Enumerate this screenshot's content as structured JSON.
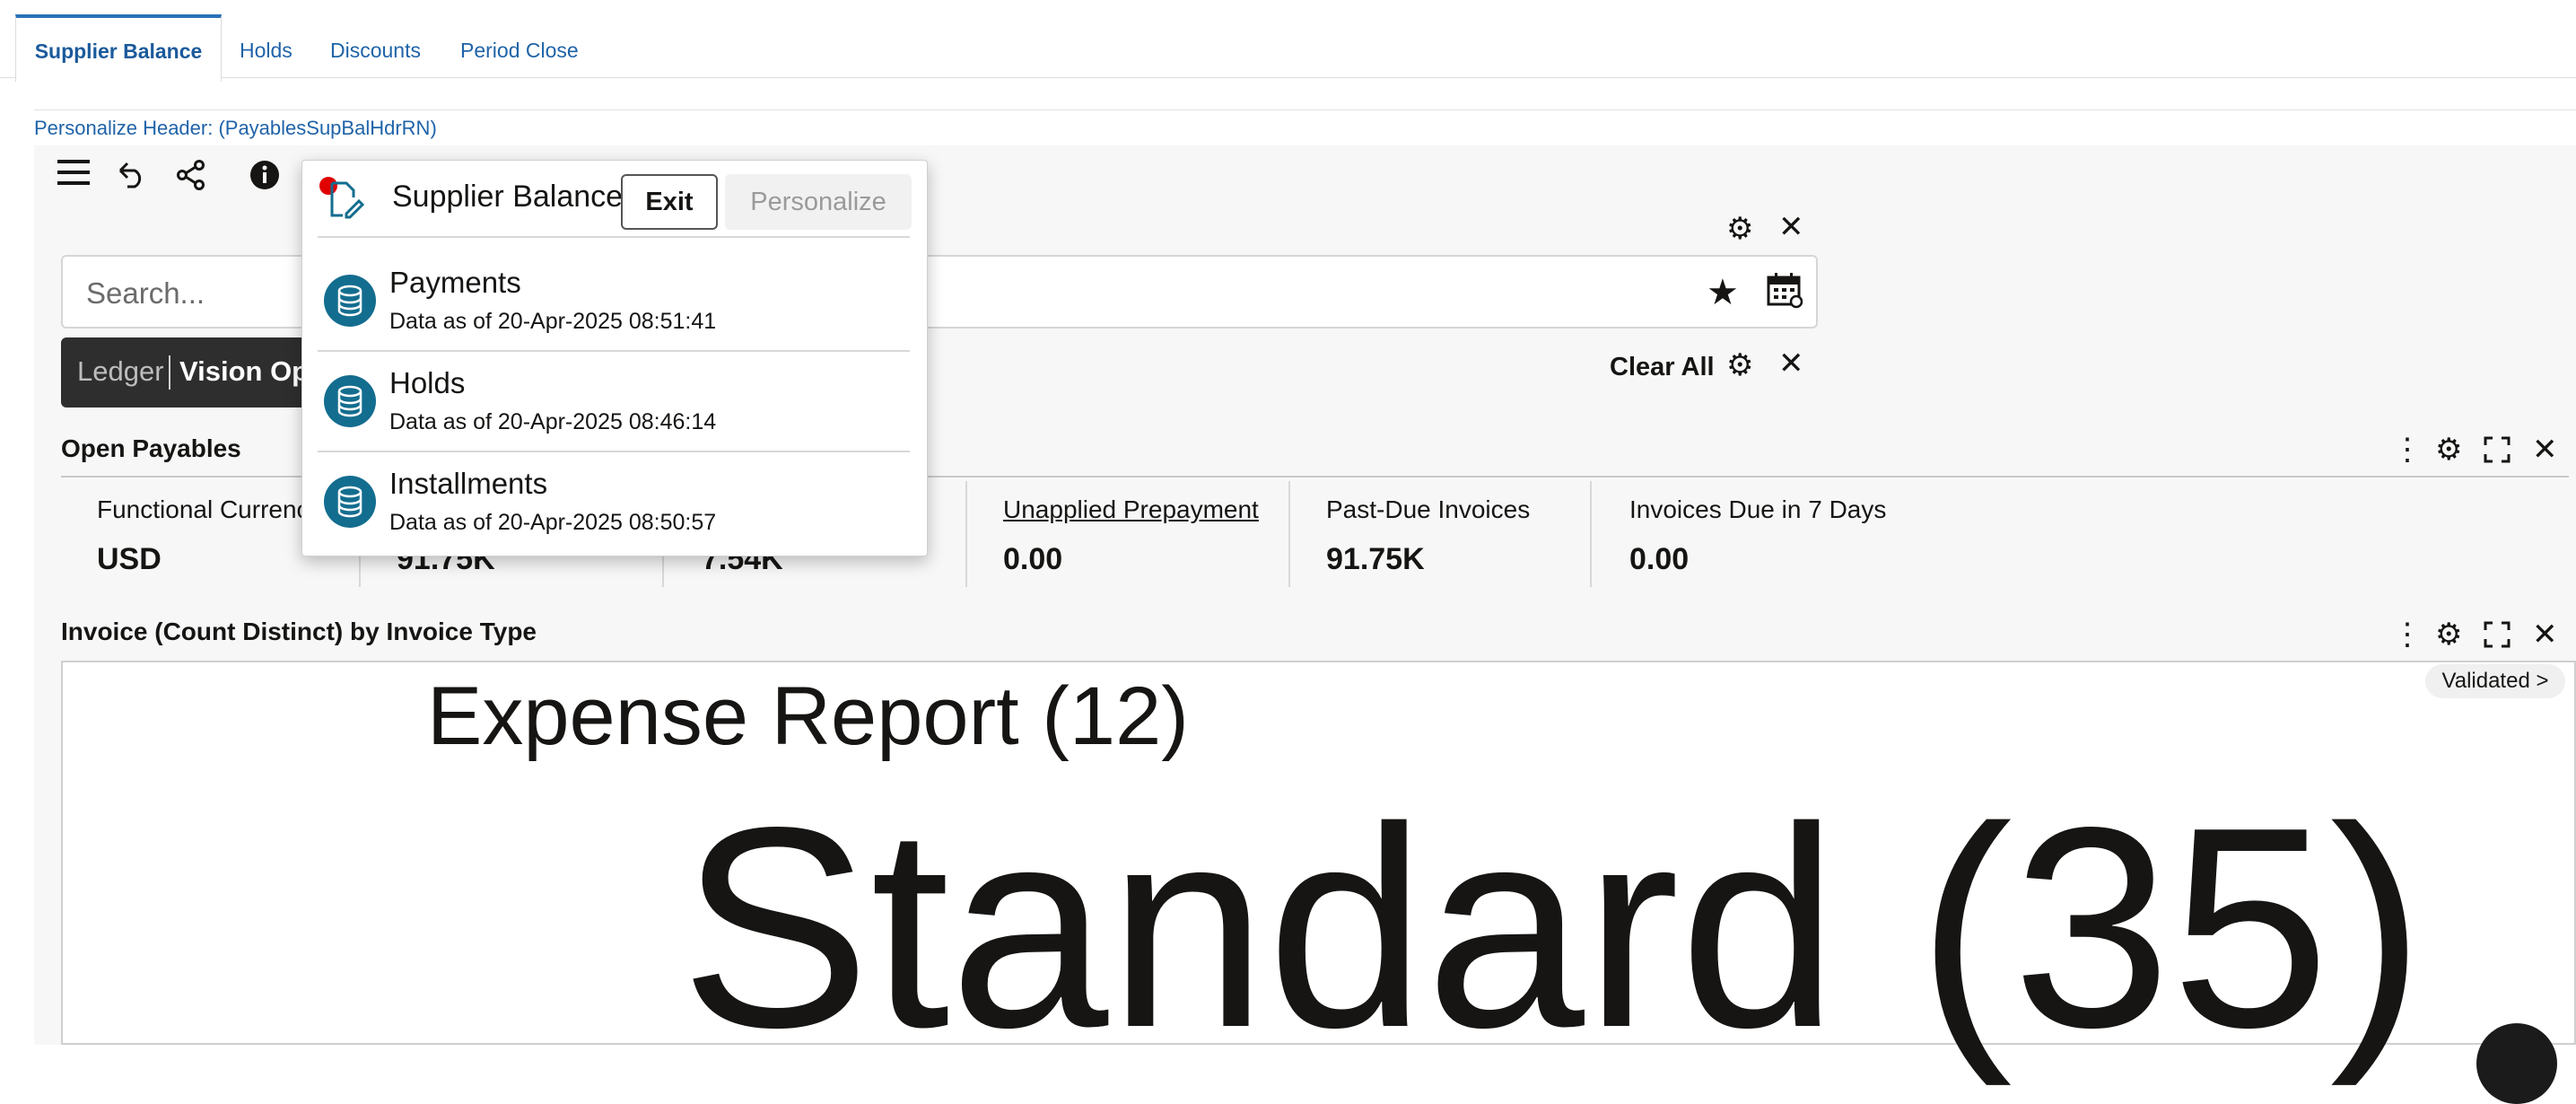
{
  "tabs": [
    {
      "label": "Supplier Balance",
      "active": true
    },
    {
      "label": "Holds",
      "active": false
    },
    {
      "label": "Discounts",
      "active": false
    },
    {
      "label": "Period Close",
      "active": false
    }
  ],
  "personalize_header": "Personalize Header: (PayablesSupBalHdrRN)",
  "toolbar": {
    "icons": [
      "hamburger-menu-icon",
      "undo-icon",
      "share-icon",
      "info-icon"
    ]
  },
  "search": {
    "placeholder": "Search..."
  },
  "filter_chip": {
    "label": "Ledger",
    "value": "Vision Operations"
  },
  "filter_bar": {
    "clear_all": "Clear All"
  },
  "open_payables": {
    "title": "Open Payables",
    "kpis": [
      {
        "label": "Functional Currency",
        "value": "USD",
        "link": false
      },
      {
        "label": "",
        "value": "91.75K",
        "link": false
      },
      {
        "label": "",
        "value": "7.54K",
        "link": false
      },
      {
        "label": "Unapplied Prepayment",
        "value": "0.00",
        "link": true
      },
      {
        "label": "Past-Due Invoices",
        "value": "91.75K",
        "link": false
      },
      {
        "label": "Invoices Due in 7 Days",
        "value": "0.00",
        "link": false
      }
    ]
  },
  "invoice_chart": {
    "title": "Invoice (Count Distinct) by Invoice Type",
    "validated_pill": "Validated >",
    "words": [
      {
        "text": "Expense Report (12)",
        "count": 12
      },
      {
        "text": "Standard (35)",
        "count": 35
      }
    ]
  },
  "popup": {
    "title": "Supplier Balance",
    "exit_label": "Exit",
    "personalize_label": "Personalize",
    "items": [
      {
        "name": "Payments",
        "date": "Data as of 20-Apr-2025 08:51:41"
      },
      {
        "name": "Holds",
        "date": "Data as of 20-Apr-2025 08:46:14"
      },
      {
        "name": "Installments",
        "date": "Data as of 20-Apr-2025 08:50:57"
      }
    ]
  }
}
